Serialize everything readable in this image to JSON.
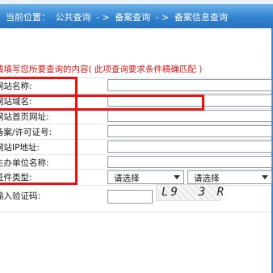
{
  "header": {
    "current_location_label": "当前位置：",
    "crumb_1": "公共查询",
    "separator": "- >",
    "crumb_2": "备案查询",
    "crumb_3": "备案信息查询"
  },
  "instruction": "请填写您所要查询的内容( 此项查询要求条件精确匹配 )",
  "form": {
    "rows": [
      {
        "label": "网站名称:",
        "value": ""
      },
      {
        "label": "网站域名:",
        "value": ""
      },
      {
        "label": "网站首页网址:",
        "value": ""
      },
      {
        "label": "备案/许可证号:",
        "value": ""
      },
      {
        "label": "网站IP地址:",
        "value": ""
      },
      {
        "label": "主办单位名称:",
        "value": ""
      }
    ],
    "cert_type_label": "证件类型:",
    "cert_type_select_1": "请选择",
    "cert_type_select_2": "请选择",
    "captcha_label": "输入验证码:",
    "captcha_text": "L9  3 R"
  },
  "colors": {
    "header_bar": "#2f7fcd",
    "instruction_text": "#d61a1a",
    "annotation_red": "#ee1111"
  }
}
